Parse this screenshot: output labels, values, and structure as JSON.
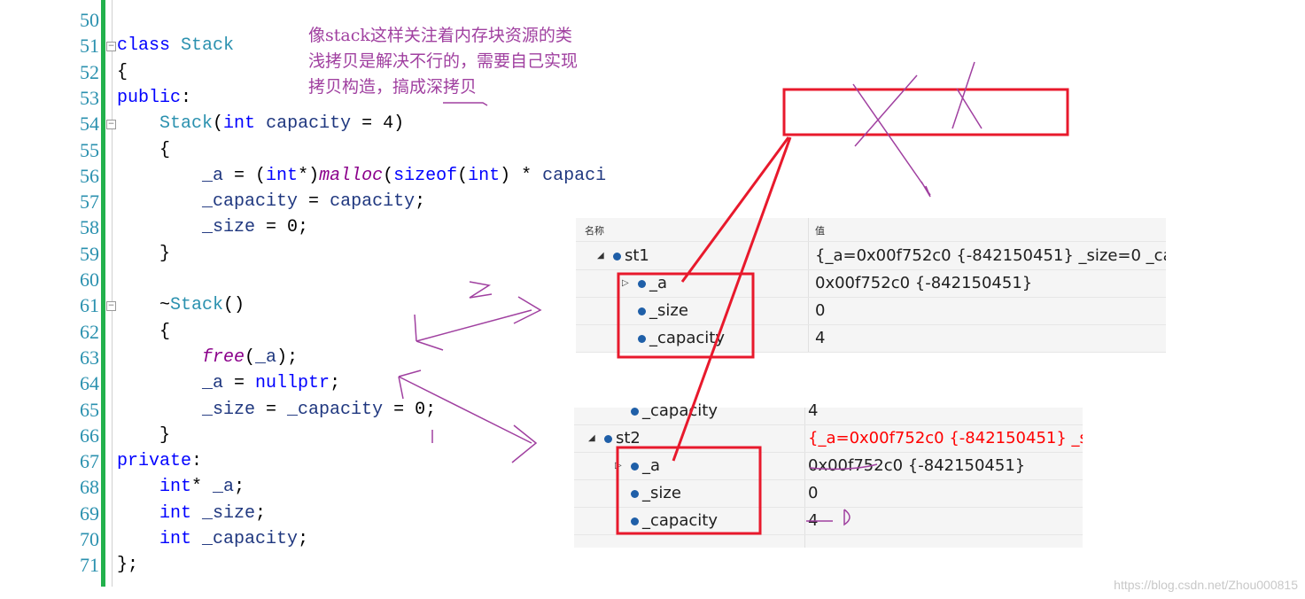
{
  "code": {
    "lines": [
      {
        "n": "50",
        "parts": []
      },
      {
        "n": "51",
        "parts": [
          [
            "kw",
            "class "
          ],
          [
            "ty",
            "Stack"
          ]
        ]
      },
      {
        "n": "52",
        "parts": [
          [
            "nu",
            "{"
          ]
        ]
      },
      {
        "n": "53",
        "parts": [
          [
            "kw",
            "public"
          ],
          [
            "nu",
            ":"
          ]
        ]
      },
      {
        "n": "54",
        "parts": [
          [
            "nu",
            "    "
          ],
          [
            "ty",
            "Stack"
          ],
          [
            "nu",
            "("
          ],
          [
            "kw",
            "int"
          ],
          [
            "mb",
            " capacity"
          ],
          [
            "nu",
            " = 4)"
          ]
        ]
      },
      {
        "n": "55",
        "parts": [
          [
            "nu",
            "    {"
          ]
        ]
      },
      {
        "n": "56",
        "parts": [
          [
            "nu",
            "        "
          ],
          [
            "mb",
            "_a"
          ],
          [
            "nu",
            " = ("
          ],
          [
            "kw",
            "int"
          ],
          [
            "nu",
            "*)"
          ],
          [
            "fn",
            "malloc"
          ],
          [
            "nu",
            "("
          ],
          [
            "kw",
            "sizeof"
          ],
          [
            "nu",
            "("
          ],
          [
            "kw",
            "int"
          ],
          [
            "nu",
            ") * "
          ],
          [
            "mb",
            "capaci"
          ]
        ]
      },
      {
        "n": "57",
        "parts": [
          [
            "nu",
            "        "
          ],
          [
            "mb",
            "_capacity"
          ],
          [
            "nu",
            " = "
          ],
          [
            "mb",
            "capacity"
          ],
          [
            "nu",
            ";"
          ]
        ]
      },
      {
        "n": "58",
        "parts": [
          [
            "nu",
            "        "
          ],
          [
            "mb",
            "_size"
          ],
          [
            "nu",
            " = 0;"
          ]
        ]
      },
      {
        "n": "59",
        "parts": [
          [
            "nu",
            "    }"
          ]
        ]
      },
      {
        "n": "60",
        "parts": []
      },
      {
        "n": "61",
        "parts": [
          [
            "nu",
            "    ~"
          ],
          [
            "ty",
            "Stack"
          ],
          [
            "nu",
            "()"
          ]
        ]
      },
      {
        "n": "62",
        "parts": [
          [
            "nu",
            "    {"
          ]
        ]
      },
      {
        "n": "63",
        "parts": [
          [
            "nu",
            "        "
          ],
          [
            "fn",
            "free"
          ],
          [
            "nu",
            "("
          ],
          [
            "mb",
            "_a"
          ],
          [
            "nu",
            ");"
          ]
        ]
      },
      {
        "n": "64",
        "parts": [
          [
            "nu",
            "        "
          ],
          [
            "mb",
            "_a"
          ],
          [
            "nu",
            " = "
          ],
          [
            "kw",
            "nullptr"
          ],
          [
            "nu",
            ";"
          ]
        ]
      },
      {
        "n": "65",
        "parts": [
          [
            "nu",
            "        "
          ],
          [
            "mb",
            "_size"
          ],
          [
            "nu",
            " = "
          ],
          [
            "mb",
            "_capacity"
          ],
          [
            "nu",
            " = 0;"
          ]
        ]
      },
      {
        "n": "66",
        "parts": [
          [
            "nu",
            "    }"
          ]
        ]
      },
      {
        "n": "67",
        "parts": [
          [
            "kw",
            "private"
          ],
          [
            "nu",
            ":"
          ]
        ]
      },
      {
        "n": "68",
        "parts": [
          [
            "nu",
            "    "
          ],
          [
            "kw",
            "int"
          ],
          [
            "nu",
            "* "
          ],
          [
            "mb",
            "_a"
          ],
          [
            "nu",
            ";"
          ]
        ]
      },
      {
        "n": "69",
        "parts": [
          [
            "nu",
            "    "
          ],
          [
            "kw",
            "int"
          ],
          [
            "mb",
            " _size"
          ],
          [
            "nu",
            ";"
          ]
        ]
      },
      {
        "n": "70",
        "parts": [
          [
            "nu",
            "    "
          ],
          [
            "kw",
            "int"
          ],
          [
            "mb",
            " _capacity"
          ],
          [
            "nu",
            ";"
          ]
        ]
      },
      {
        "n": "71",
        "parts": [
          [
            "nu",
            "};"
          ]
        ]
      }
    ]
  },
  "note": {
    "line1": "像stack这样关注着内存块资源的类",
    "line2": "浅拷贝是解决不行的，需要自己实现",
    "line3": "拷贝构造，搞成深拷贝"
  },
  "watch1": {
    "col_name": "名称",
    "col_value": "值",
    "rows": [
      {
        "name": "st1",
        "value": "{_a=0x00f752c0 {-842150451} _size=0 _ca"
      },
      {
        "name": "_a",
        "value": "0x00f752c0 {-842150451}"
      },
      {
        "name": "_size",
        "value": "0"
      },
      {
        "name": "_capacity",
        "value": "4"
      }
    ]
  },
  "watch2": {
    "rows": [
      {
        "name": "_capacity",
        "value": "4"
      },
      {
        "name": "st2",
        "value": "{_a=0x00f752c0 {-842150451} _s"
      },
      {
        "name": "_a",
        "value": "0x00f752c0 {-842150451}"
      },
      {
        "name": "_size",
        "value": "0"
      },
      {
        "name": "_capacity",
        "value": "4"
      }
    ]
  },
  "colors": {
    "highlight": "#ff0000",
    "annotation": "#a040a0",
    "keyword": "#0000ff",
    "type": "#2b91af"
  },
  "watermark": "https://blog.csdn.net/Zhou000815"
}
